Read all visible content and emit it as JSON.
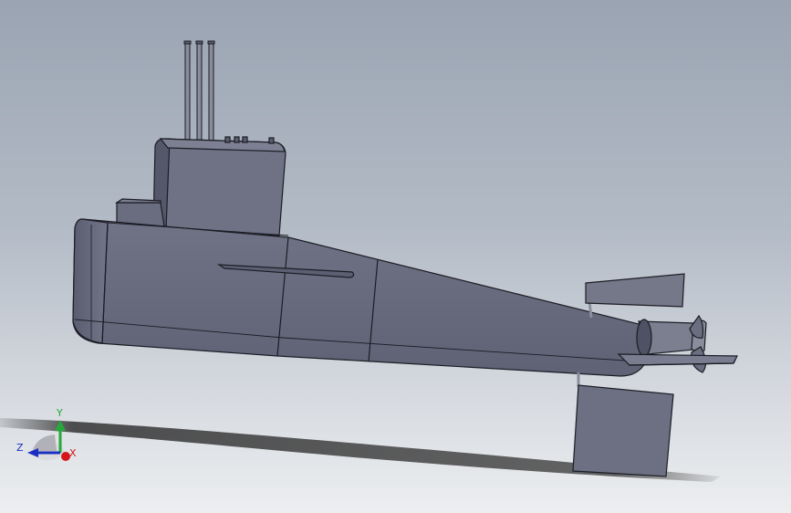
{
  "viewport": {
    "background_top": "#9aa4b2",
    "background_bottom": "#eceef0"
  },
  "model": {
    "hull_color": "#6b6e80",
    "hull_dark": "#4f5264",
    "edge_color": "#1b1c24",
    "shadow_color": "#2a2a2a"
  },
  "triad": {
    "icon": "coordinate-triad-icon",
    "x_label": "X",
    "y_label": "Y",
    "z_label": "Z",
    "x_color": "#d4161b",
    "y_color": "#27a83a",
    "z_color": "#1a2fbf"
  }
}
